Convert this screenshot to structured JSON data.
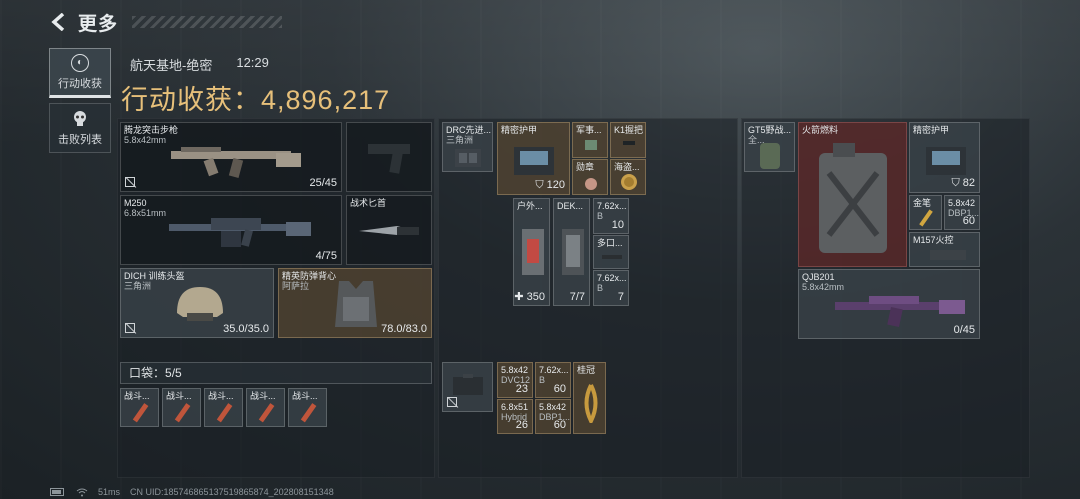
{
  "header": {
    "back_icon": "back-arrow-icon",
    "title": "更多"
  },
  "tabs": [
    {
      "label": "行动收获",
      "icon": "loot-icon",
      "active": true
    },
    {
      "label": "击败列表",
      "icon": "skull-icon",
      "active": false
    }
  ],
  "match": {
    "map": "航天基地-绝密",
    "time": "12:29",
    "haul_label": "行动收获：",
    "haul_value": "4,896,217"
  },
  "loadout": {
    "primary_weapon": {
      "name": "腾龙突击步枪",
      "caliber": "5.8x42mm",
      "ammo": "25/45"
    },
    "secondary_weapon": {
      "name": "M250",
      "caliber": "6.8x51mm",
      "ammo": "4/75"
    },
    "knife": {
      "name": "战术匕首"
    },
    "helmet": {
      "name": "DICH 训练头盔",
      "faction": "三角洲",
      "durability": "35.0/35.0"
    },
    "armor": {
      "name": "精英防弹背心",
      "faction": "阿萨拉",
      "durability": "78.0/83.0"
    },
    "pocket": {
      "label": "口袋：",
      "count": "5/5",
      "items": [
        "战斗...",
        "战斗...",
        "战斗...",
        "战斗...",
        "战斗..."
      ]
    }
  },
  "rig": {
    "chest_rig": {
      "name": "DRC先进...",
      "faction": "三角洲"
    },
    "items": [
      {
        "name": "精密护甲",
        "value": "120"
      },
      {
        "name": "军事..."
      },
      {
        "name": "K1握把"
      },
      {
        "name": "勋章"
      },
      {
        "name": "海盗..."
      },
      {
        "name": "户外...",
        "value": "350"
      },
      {
        "name": "DEK...",
        "value": "7/7"
      },
      {
        "name": "7.62x...",
        "sub": "B",
        "value": "10"
      },
      {
        "name": "多口..."
      },
      {
        "name": "7.62x...",
        "sub": "B",
        "value": "7"
      }
    ]
  },
  "case": {
    "ammo": [
      {
        "name": "5.8x42",
        "sub": "DVC12",
        "value": "23"
      },
      {
        "name": "7.62x...",
        "sub": "B",
        "value": "60"
      },
      {
        "name": "桂冠"
      },
      {
        "name": "6.8x51",
        "sub": "Hybrid",
        "value": "26"
      },
      {
        "name": "5.8x42",
        "sub": "DBP1...",
        "value": "60"
      }
    ]
  },
  "backpack": {
    "bag": {
      "name": "GT5野战...",
      "faction": "全..."
    },
    "items": [
      {
        "name": "火箭燃料"
      },
      {
        "name": "精密护甲",
        "value": "82"
      },
      {
        "name": "金笔"
      },
      {
        "name": "5.8x42",
        "sub": "DBP1...",
        "value": "60"
      },
      {
        "name": "M157火控"
      },
      {
        "name": "QJB201",
        "sub": "5.8x42mm",
        "value": "0/45"
      }
    ]
  },
  "status_bar": {
    "ping": "51ms",
    "uid": "CN UID:185746865137519865874_202808151348"
  }
}
